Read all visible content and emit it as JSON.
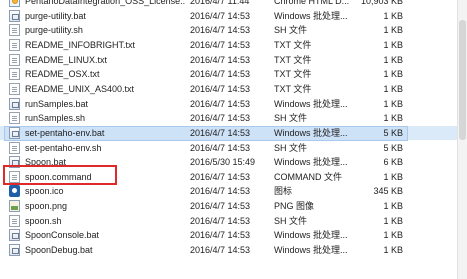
{
  "files": [
    {
      "name": "PentahoDataIntegration_OSS_License...",
      "date": "2016/4/7 11:44",
      "type": "Chrome HTML D...",
      "size": "10,903 KB",
      "icon": "html-file-icon"
    },
    {
      "name": "purge-utility.bat",
      "date": "2016/4/7 14:53",
      "type": "Windows 批处理...",
      "size": "1 KB",
      "icon": "batch-file-icon"
    },
    {
      "name": "purge-utility.sh",
      "date": "2016/4/7 14:53",
      "type": "SH 文件",
      "size": "1 KB",
      "icon": "text-file-icon"
    },
    {
      "name": "README_INFOBRIGHT.txt",
      "date": "2016/4/7 14:53",
      "type": "TXT 文件",
      "size": "1 KB",
      "icon": "text-file-icon"
    },
    {
      "name": "README_LINUX.txt",
      "date": "2016/4/7 14:53",
      "type": "TXT 文件",
      "size": "1 KB",
      "icon": "text-file-icon"
    },
    {
      "name": "README_OSX.txt",
      "date": "2016/4/7 14:53",
      "type": "TXT 文件",
      "size": "1 KB",
      "icon": "text-file-icon"
    },
    {
      "name": "README_UNIX_AS400.txt",
      "date": "2016/4/7 14:53",
      "type": "TXT 文件",
      "size": "1 KB",
      "icon": "text-file-icon"
    },
    {
      "name": "runSamples.bat",
      "date": "2016/4/7 14:53",
      "type": "Windows 批处理...",
      "size": "1 KB",
      "icon": "batch-file-icon"
    },
    {
      "name": "runSamples.sh",
      "date": "2016/4/7 14:53",
      "type": "SH 文件",
      "size": "1 KB",
      "icon": "text-file-icon"
    },
    {
      "name": "set-pentaho-env.bat",
      "date": "2016/4/7 14:53",
      "type": "Windows 批处理...",
      "size": "5 KB",
      "icon": "batch-file-icon",
      "selected": true
    },
    {
      "name": "set-pentaho-env.sh",
      "date": "2016/4/7 14:53",
      "type": "SH 文件",
      "size": "5 KB",
      "icon": "text-file-icon"
    },
    {
      "name": "Spoon.bat",
      "date": "2016/5/30 15:49",
      "type": "Windows 批处理...",
      "size": "6 KB",
      "icon": "batch-file-icon",
      "highlighted": true
    },
    {
      "name": "spoon.command",
      "date": "2016/4/7 14:53",
      "type": "COMMAND 文件",
      "size": "1 KB",
      "icon": "text-file-icon"
    },
    {
      "name": "spoon.ico",
      "date": "2016/4/7 14:53",
      "type": "图标",
      "size": "345 KB",
      "icon": "spoon-icon"
    },
    {
      "name": "spoon.png",
      "date": "2016/4/7 14:53",
      "type": "PNG 图像",
      "size": "1 KB",
      "icon": "image-file-icon"
    },
    {
      "name": "spoon.sh",
      "date": "2016/4/7 14:53",
      "type": "SH 文件",
      "size": "1 KB",
      "icon": "text-file-icon"
    },
    {
      "name": "SpoonConsole.bat",
      "date": "2016/4/7 14:53",
      "type": "Windows 批处理...",
      "size": "1 KB",
      "icon": "batch-file-icon"
    },
    {
      "name": "SpoonDebug.bat",
      "date": "2016/4/7 14:53",
      "type": "Windows 批处理...",
      "size": "1 KB",
      "icon": "batch-file-icon"
    }
  ]
}
